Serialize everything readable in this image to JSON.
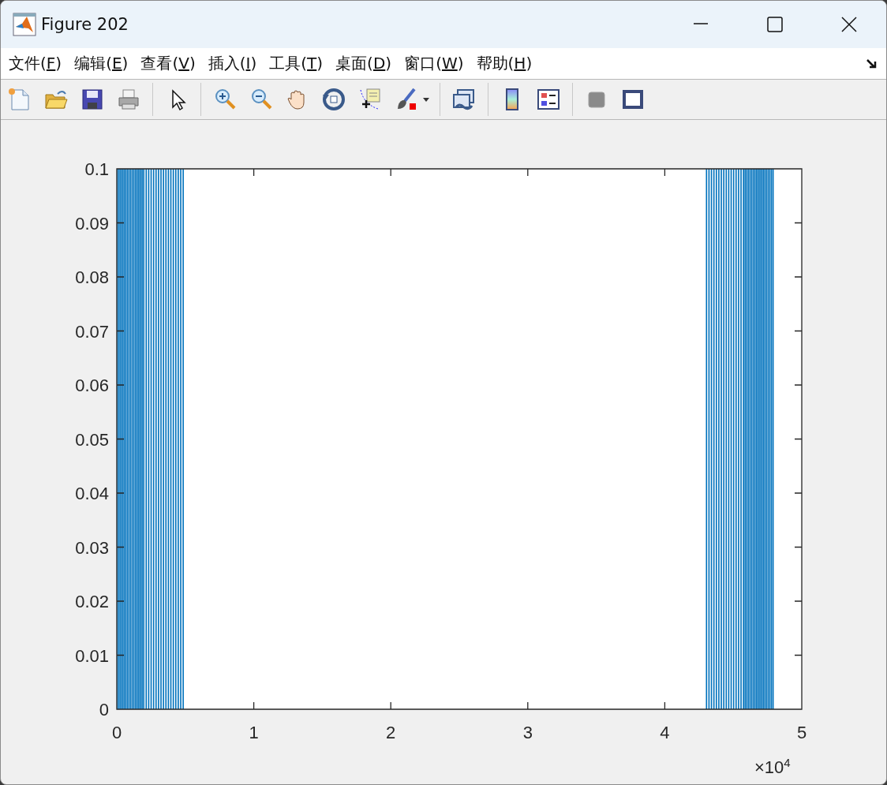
{
  "window": {
    "title": "Figure 202"
  },
  "menu": [
    {
      "before": "文件(",
      "key": "F",
      "after": ")"
    },
    {
      "before": "编辑(",
      "key": "E",
      "after": ")"
    },
    {
      "before": "查看(",
      "key": "V",
      "after": ")"
    },
    {
      "before": "插入(",
      "key": "I",
      "after": ")"
    },
    {
      "before": "工具(",
      "key": "T",
      "after": ")"
    },
    {
      "before": "桌面(",
      "key": "D",
      "after": ")"
    },
    {
      "before": "窗口(",
      "key": "W",
      "after": ")"
    },
    {
      "before": "帮助(",
      "key": "H",
      "after": ")"
    }
  ],
  "figure": {
    "x_multiplier": "×10$^{4}$",
    "chart_data": {
      "type": "bar",
      "x": [
        0,
        0.012,
        0.024,
        0.036,
        0.048,
        0.06,
        0.072,
        0.084,
        0.096,
        0.108,
        0.12,
        0.132,
        0.144,
        0.156,
        0.168,
        0.18,
        0.192,
        0.21,
        0.228,
        0.246,
        0.264,
        0.282,
        0.3,
        0.318,
        0.336,
        0.354,
        0.372,
        0.39,
        0.408,
        0.426,
        0.444,
        0.462,
        0.48,
        4.3,
        4.318,
        4.336,
        4.354,
        4.372,
        4.39,
        4.408,
        4.426,
        4.444,
        4.462,
        4.48,
        4.498,
        4.516,
        4.534,
        4.552,
        4.57,
        4.582,
        4.594,
        4.606,
        4.618,
        4.63,
        4.642,
        4.654,
        4.666,
        4.678,
        4.69,
        4.702,
        4.714,
        4.726,
        4.738,
        4.75,
        4.762,
        4.774,
        4.786
      ],
      "series": [
        {
          "color": "#0072bd",
          "values": [
            0.1,
            0.1,
            0.1,
            0.1,
            0.1,
            0.1,
            0.1,
            0.1,
            0.1,
            0.1,
            0.1,
            0.1,
            0.1,
            0.1,
            0.1,
            0.1,
            0.1,
            0.1,
            0.1,
            0.1,
            0.1,
            0.1,
            0.1,
            0.1,
            0.1,
            0.1,
            0.1,
            0.1,
            0.1,
            0.1,
            0.1,
            0.1,
            0.1,
            0.1,
            0.1,
            0.1,
            0.1,
            0.1,
            0.1,
            0.1,
            0.1,
            0.1,
            0.1,
            0.1,
            0.1,
            0.1,
            0.1,
            0.1,
            0.1,
            0.1,
            0.1,
            0.1,
            0.1,
            0.1,
            0.1,
            0.1,
            0.1,
            0.1,
            0.1,
            0.1,
            0.1,
            0.1,
            0.1,
            0.1,
            0.1,
            0.1,
            0.1
          ]
        }
      ],
      "xlim": [
        0,
        5
      ],
      "ylim": [
        0,
        0.1
      ],
      "xticks": [
        0,
        1,
        2,
        3,
        4,
        5
      ],
      "yticks": [
        {
          "value": 0,
          "label": "0"
        },
        {
          "value": 0.01,
          "label": "0.01"
        },
        {
          "value": 0.02,
          "label": "0.02"
        },
        {
          "value": 0.03,
          "label": "0.03"
        },
        {
          "value": 0.04,
          "label": "0.04"
        },
        {
          "value": 0.05,
          "label": "0.05"
        },
        {
          "value": 0.06,
          "label": "0.06"
        },
        {
          "value": 0.07,
          "label": "0.07"
        },
        {
          "value": 0.08,
          "label": "0.08"
        },
        {
          "value": 0.09,
          "label": "0.09"
        },
        {
          "value": 0.1,
          "label": "0.1"
        }
      ]
    }
  }
}
